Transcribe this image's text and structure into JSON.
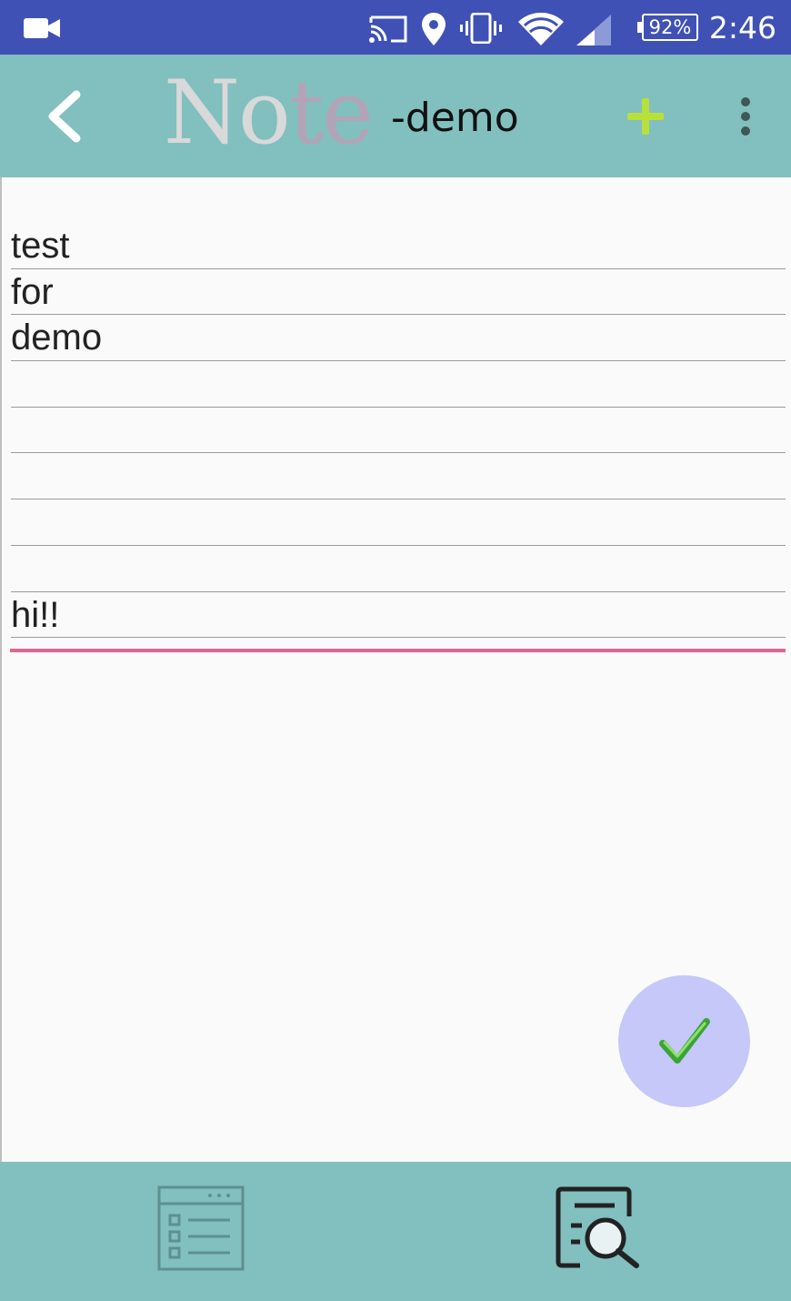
{
  "status_bar": {
    "time": "2:46",
    "battery": "92%",
    "icons": [
      "video-camera-icon",
      "cast-icon",
      "location-pin-icon",
      "vibrate-icon",
      "wifi-icon",
      "signal-icon",
      "battery-icon"
    ]
  },
  "toolbar": {
    "logo_part1": "No",
    "logo_part2": "te",
    "subtitle": "-demo",
    "colors": {
      "background": "#82bfbf",
      "add": "#b8e03a"
    }
  },
  "note": {
    "lines": [
      "test",
      "for",
      "demo",
      "",
      "",
      "",
      "",
      "",
      "hi!!"
    ],
    "focus_color": "#e06694"
  },
  "fab": {
    "icon": "checkmark-icon",
    "color": "#c5c8f8"
  },
  "bottom_bar": {
    "icons": [
      "note-list-icon",
      "search-note-icon"
    ]
  }
}
